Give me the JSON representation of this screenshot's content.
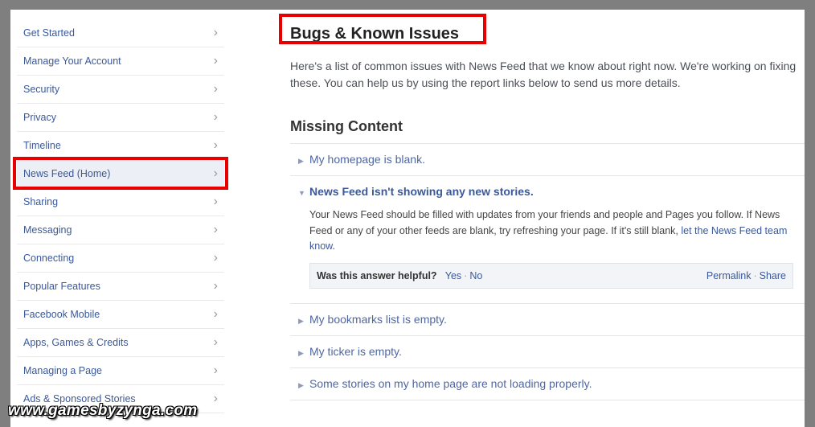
{
  "sidebar": {
    "items": [
      {
        "label": "Get Started"
      },
      {
        "label": "Manage Your Account"
      },
      {
        "label": "Security"
      },
      {
        "label": "Privacy"
      },
      {
        "label": "Timeline"
      },
      {
        "label": "News Feed (Home)"
      },
      {
        "label": "Sharing"
      },
      {
        "label": "Messaging"
      },
      {
        "label": "Connecting"
      },
      {
        "label": "Popular Features"
      },
      {
        "label": "Facebook Mobile"
      },
      {
        "label": "Apps, Games & Credits"
      },
      {
        "label": "Managing a Page"
      },
      {
        "label": "Ads & Sponsored Stories"
      }
    ],
    "chevron": "›"
  },
  "main": {
    "title": "Bugs & Known Issues",
    "intro": "Here's a list of common issues with News Feed that we know about right now. We're working on fixing these. You can help us by using the report links below to send us more details.",
    "section_title": "Missing Content",
    "questions": [
      {
        "label": "My homepage is blank."
      },
      {
        "label": "News Feed isn't showing any new stories.",
        "answer_text": "Your News Feed should be filled with updates from your friends and people and Pages you follow. If News Feed or any of your other feeds are blank, try refreshing your page. If it's still blank, ",
        "answer_link": "let the News Feed team know",
        "answer_end": "."
      },
      {
        "label": "My bookmarks list is empty."
      },
      {
        "label": "My ticker is empty."
      },
      {
        "label": "Some stories on my home page are not loading properly."
      }
    ],
    "helpful": {
      "question": "Was this answer helpful?",
      "yes": "Yes",
      "no": "No",
      "permalink": "Permalink",
      "share": "Share",
      "separator": "·"
    },
    "collapsed_icon": "▶",
    "expanded_icon": "▼"
  },
  "watermark": "www.gamesbyzynga.com",
  "colors": {
    "highlight": "#e60000",
    "link": "#3b5998",
    "background": "#7f7f7f"
  }
}
